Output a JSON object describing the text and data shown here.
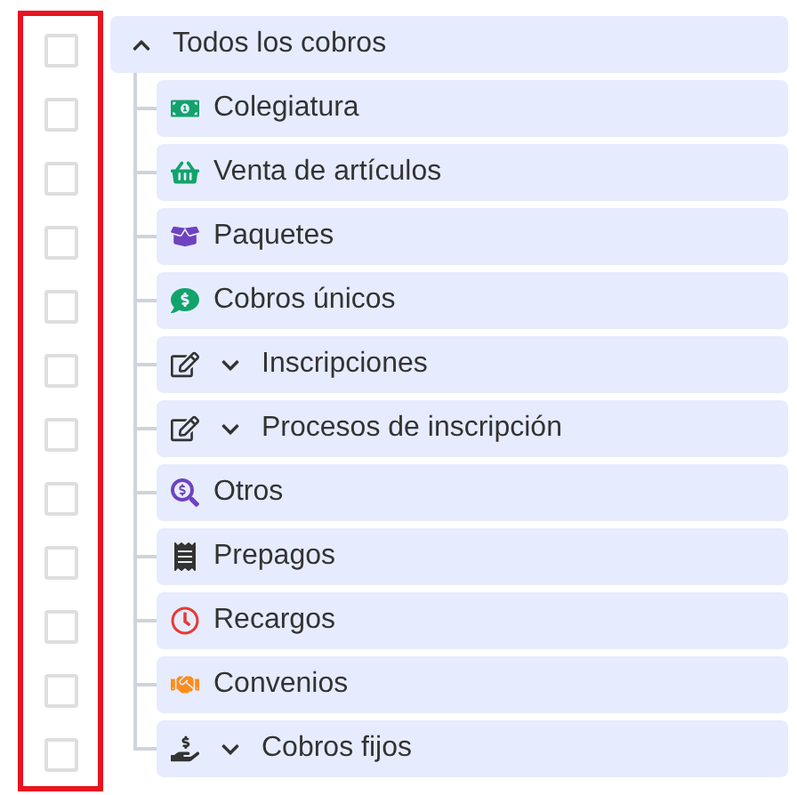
{
  "tree": {
    "label": "Todos los cobros",
    "expanded": true,
    "checked": false,
    "children": [
      {
        "label": "Colegiatura",
        "kind": "cash",
        "checked": false
      },
      {
        "label": "Venta de artículos",
        "kind": "basket",
        "checked": false
      },
      {
        "label": "Paquetes",
        "kind": "box",
        "checked": false
      },
      {
        "label": "Cobros únicos",
        "kind": "chat",
        "checked": false
      },
      {
        "label": "Inscripciones",
        "kind": "edit",
        "checked": false,
        "expanded": false
      },
      {
        "label": "Procesos de inscripción",
        "kind": "edit",
        "checked": false,
        "expanded": false
      },
      {
        "label": "Otros",
        "kind": "search",
        "checked": false
      },
      {
        "label": "Prepagos",
        "kind": "receipt",
        "checked": false
      },
      {
        "label": "Recargos",
        "kind": "clock",
        "checked": false
      },
      {
        "label": "Convenios",
        "kind": "handshake",
        "checked": false
      },
      {
        "label": "Cobros fijos",
        "kind": "coin",
        "checked": false,
        "expanded": false
      }
    ]
  }
}
